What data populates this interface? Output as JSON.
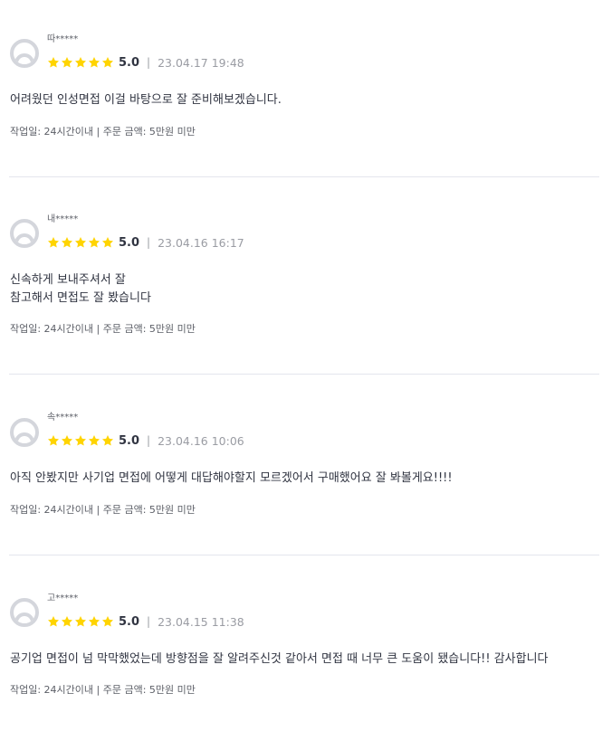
{
  "colors": {
    "star": "#ffd400",
    "text": "#303441",
    "muted": "#9a9ca3",
    "divider": "#e4e5ed"
  },
  "reviews": [
    {
      "nickname": "따*****",
      "rating": "5.0",
      "stars": 5,
      "date": "23.04.17 19:48",
      "comment_lines": [
        "어려웠던 인성면접 이걸 바탕으로 잘 준비해보겠습니다."
      ],
      "detail": "작업일: 24시간이내 | 주문 금액: 5만원 미만"
    },
    {
      "nickname": "내*****",
      "rating": "5.0",
      "stars": 5,
      "date": "23.04.16 16:17",
      "comment_lines": [
        "신속하게 보내주셔서 잘",
        "참고해서 면접도 잘 봤습니다"
      ],
      "detail": "작업일: 24시간이내 | 주문 금액: 5만원 미만"
    },
    {
      "nickname": "속*****",
      "rating": "5.0",
      "stars": 5,
      "date": "23.04.16 10:06",
      "comment_lines": [
        "아직 안봤지만 사기업 면접에 어떻게 대답해야할지 모르겠어서 구매했어요 잘 봐볼게요!!!!"
      ],
      "detail": "작업일: 24시간이내 | 주문 금액: 5만원 미만"
    },
    {
      "nickname": "고*****",
      "rating": "5.0",
      "stars": 5,
      "date": "23.04.15 11:38",
      "comment_lines": [
        "공기업 면접이 넘 막막했었는데 방향점을 잘 알려주신것 같아서 면접 때 너무 큰 도움이 됐습니다!! 감사합니다"
      ],
      "detail": "작업일: 24시간이내 | 주문 금액: 5만원 미만"
    }
  ]
}
